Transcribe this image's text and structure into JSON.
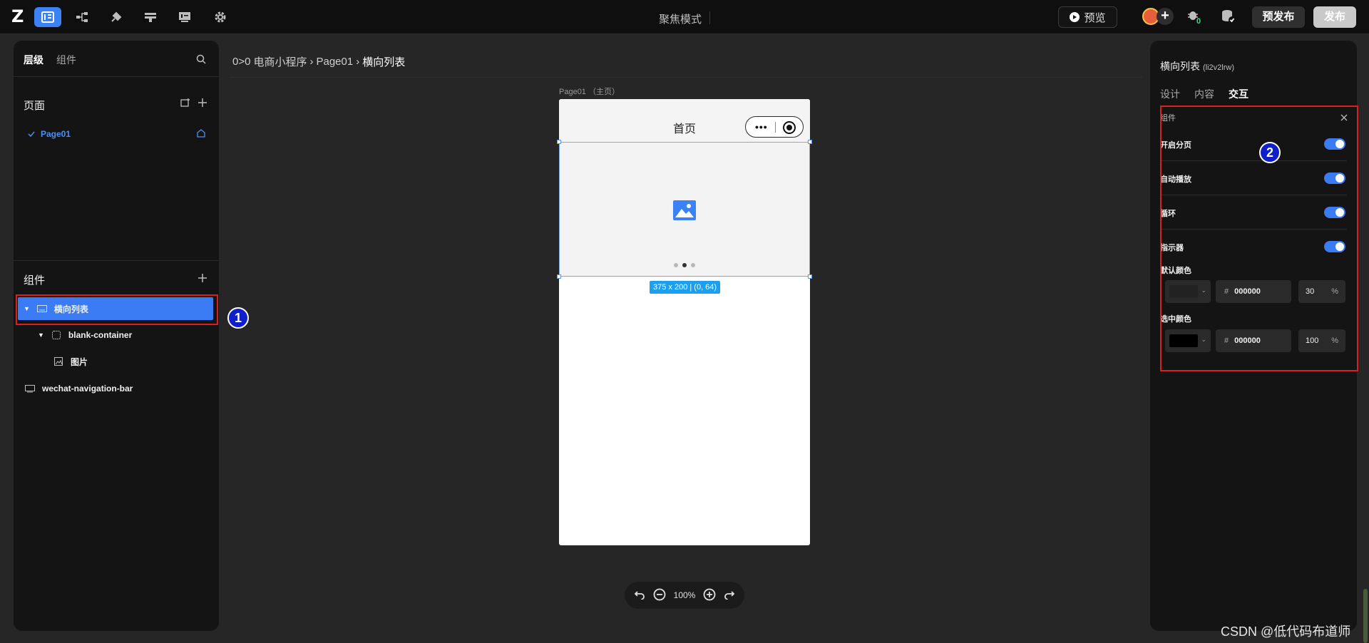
{
  "topbar": {
    "logo": "Z",
    "mode_label": "聚焦模式",
    "preview_label": "预览",
    "prepublish_label": "预发布",
    "publish_label": "发布",
    "bug_count": "0",
    "icons": [
      "pages-icon",
      "flow-icon",
      "plugin-icon",
      "layers-icon",
      "monitor-icon",
      "gear-icon"
    ]
  },
  "left_panel": {
    "tabs": [
      "层级",
      "组件"
    ],
    "pages_title": "页面",
    "pages": [
      {
        "label": "Page01"
      }
    ],
    "components_title": "组件",
    "tree": [
      {
        "label": "横向列表",
        "selected": true
      },
      {
        "label": "blank-container"
      },
      {
        "label": "图片"
      },
      {
        "label": "wechat-navigation-bar"
      }
    ]
  },
  "canvas": {
    "breadcrumb": [
      "电商小程序",
      "Page01",
      "横向列表"
    ],
    "breadcrumb_icon": "0>0",
    "page_label": "Page01 （主页）",
    "phone_title": "首页",
    "capsule_dots": "•••",
    "size_tag": "375 x 200 | (0, 64)",
    "zoom": "100%"
  },
  "annotations": [
    "1",
    "2"
  ],
  "right_panel": {
    "title": "横向列表",
    "component_id": "(li2v2lrw)",
    "tabs": [
      "设计",
      "内容",
      "交互"
    ],
    "active_tab": "交互",
    "group_label": "组件",
    "settings": [
      {
        "label": "开启分页",
        "on": true
      },
      {
        "label": "自动播放",
        "on": true
      },
      {
        "label": "循环",
        "on": true
      },
      {
        "label": "指示器",
        "on": true
      }
    ],
    "default_color": {
      "label": "默认颜色",
      "swatch": "#222222",
      "hex": "000000",
      "percent": "30",
      "unit": "%"
    },
    "selected_color": {
      "label": "选中颜色",
      "swatch": "#000000",
      "hex": "000000",
      "percent": "100",
      "unit": "%"
    }
  },
  "watermark": "CSDN @低代码布道师",
  "colors": {
    "accent": "#3b7cf5",
    "annotation_red": "#d92020",
    "annotation_blue": "#1020c8"
  }
}
